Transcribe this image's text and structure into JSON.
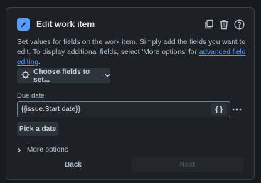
{
  "header": {
    "title": "Edit work item",
    "icons": [
      "pencil-icon",
      "copy-icon",
      "trash-icon",
      "help-icon"
    ]
  },
  "description": {
    "text": "Set values for fields on the work item. Simply add the fields you want to edit. To display additional fields, select 'More options' for",
    "link": "advanced field editing",
    "suffix": "."
  },
  "choose_fields": {
    "label": "Choose fields to set...",
    "icon": "gear-icon"
  },
  "due_date": {
    "label": "Due date",
    "value": "{{issue.Start date}}",
    "smart_value_button": "{}",
    "more_icon": "more-dots-icon"
  },
  "pick_date": {
    "label": "Pick a date"
  },
  "more_options": {
    "label": "More options"
  },
  "footer": {
    "back_label": "Back",
    "next_label": "Next"
  },
  "colors": {
    "accent": "#579dff",
    "panel_bg": "#1d2125",
    "button_bg": "#2c333a",
    "disabled_text": "#4a535c"
  }
}
